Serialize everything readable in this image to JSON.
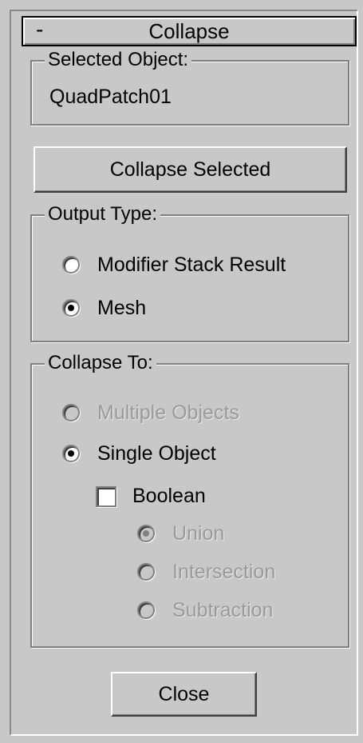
{
  "rollout": {
    "toggle": "-",
    "title": "Collapse"
  },
  "selected_object": {
    "label": "Selected Object:",
    "value": "QuadPatch01"
  },
  "collapse_selected_button": "Collapse Selected",
  "output_type": {
    "label": "Output Type:",
    "options": [
      {
        "label": "Modifier Stack Result",
        "checked": false,
        "enabled": true
      },
      {
        "label": "Mesh",
        "checked": true,
        "enabled": true
      }
    ]
  },
  "collapse_to": {
    "label": "Collapse To:",
    "options": [
      {
        "label": "Multiple Objects",
        "checked": false,
        "enabled": false
      },
      {
        "label": "Single Object",
        "checked": true,
        "enabled": true
      }
    ],
    "boolean": {
      "label": "Boolean",
      "checked": false,
      "options": [
        {
          "label": "Union",
          "checked": true,
          "enabled": false
        },
        {
          "label": "Intersection",
          "checked": false,
          "enabled": false
        },
        {
          "label": "Subtraction",
          "checked": false,
          "enabled": false
        }
      ]
    }
  },
  "close_button": "Close"
}
